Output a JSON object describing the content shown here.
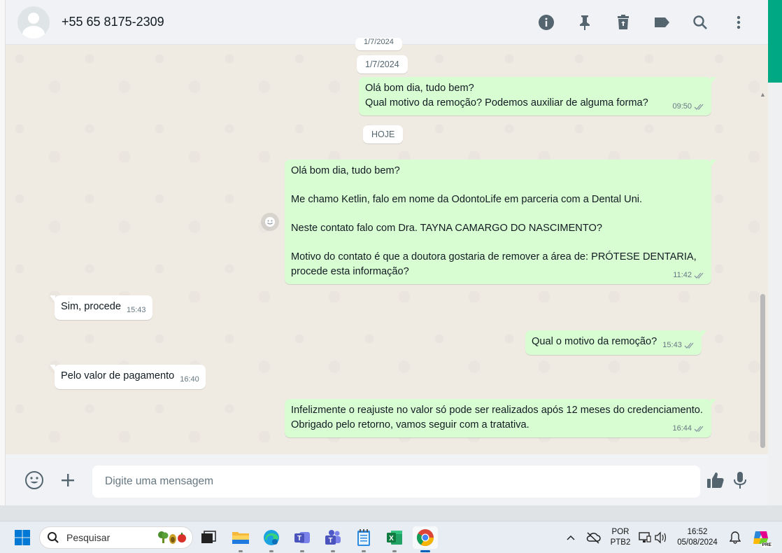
{
  "header": {
    "contact_name": "+55 65 8175-2309",
    "icons": [
      "info-icon",
      "pin-icon",
      "delete-icon",
      "label-icon",
      "search-icon",
      "menu-icon"
    ]
  },
  "messages": {
    "date_partial": "1/7/2024",
    "date_prev": "1/7/2024",
    "date_today": "HOJE",
    "m1": {
      "text": "Olá bom dia, tudo bem?\nQual motivo da remoção? Podemos auxiliar de alguma forma?",
      "time": "09:50"
    },
    "m2": {
      "text": "Olá bom dia, tudo bem?\n\nMe chamo Ketlin, falo em nome da OdontoLife em parceria com a Dental Uni.\n\nNeste contato falo com Dra. TAYNA CAMARGO DO NASCIMENTO?\n\nMotivo do contato é que a doutora gostaria de remover a área de: PRÓTESE DENTARIA, procede esta informação?",
      "time": "11:42"
    },
    "m3": {
      "text": "Sim, procede",
      "time": "15:43"
    },
    "m4": {
      "text": "Qual o motivo da remoção?",
      "time": "15:43"
    },
    "m5": {
      "text": "Pelo valor de pagamento",
      "time": "16:40"
    },
    "m6": {
      "text": "Infelizmente o reajuste no valor só pode ser realizados após 12 meses do credenciamento. Obrigado pelo retorno, vamos seguir com a tratativa.",
      "time": "16:44"
    }
  },
  "footer": {
    "placeholder": "Digite uma mensagem"
  },
  "taskbar": {
    "search_label": "Pesquisar",
    "lang_line1": "POR",
    "lang_line2": "PTB2",
    "time": "16:52",
    "date": "05/08/2024",
    "copilot_badge": "PRE"
  },
  "colors": {
    "outgoing_bubble": "#d9fdd3",
    "incoming_bubble": "#ffffff",
    "chat_background": "#efeae2",
    "accent": "#00a884",
    "read_ticks": "#667781"
  }
}
